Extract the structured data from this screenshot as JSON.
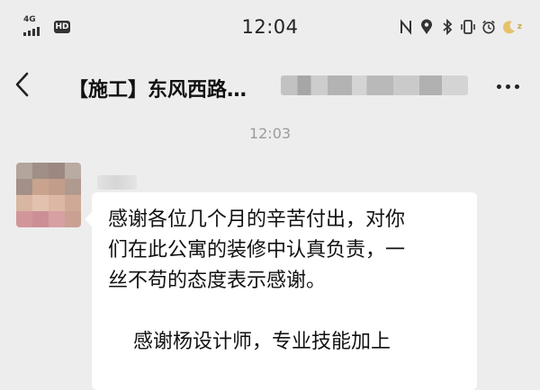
{
  "status_bar": {
    "network": "4G",
    "hd_badge": "HD",
    "time": "12:04",
    "icons": [
      "nfc-icon",
      "location-icon",
      "bluetooth-icon",
      "vibrate-icon",
      "alarm-icon",
      "battery-icon"
    ],
    "battery_label": "z"
  },
  "header": {
    "title": "【施工】东风西路…",
    "back_icon": "chevron-left-icon",
    "more_icon": "more-icon"
  },
  "chat": {
    "timestamp": "12:03",
    "message": {
      "lines": [
        "感谢各位几个月的辛苦付出，对你",
        "们在此公寓的装修中认真负责，一",
        "丝不苟的态度表示感谢。",
        "",
        "    感谢杨设计师，专业技能加上"
      ]
    }
  },
  "colors": {
    "background": "#ededed",
    "bubble": "#ffffff",
    "timestamp": "#9c9c9c",
    "text": "#111111"
  }
}
